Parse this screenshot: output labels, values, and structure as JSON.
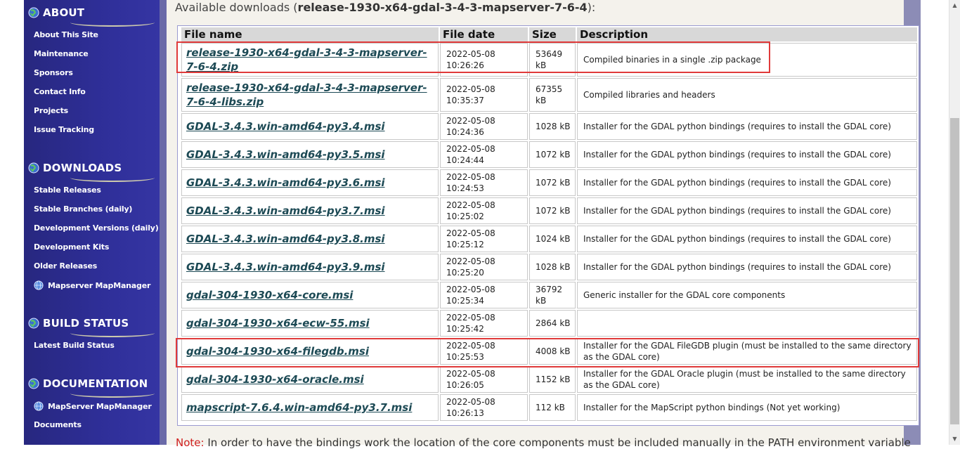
{
  "sidebar": {
    "sections": [
      {
        "title": "ABOUT",
        "items": [
          {
            "label": "About This Site"
          },
          {
            "label": "Maintenance"
          },
          {
            "label": "Sponsors"
          },
          {
            "label": "Contact Info"
          },
          {
            "label": "Projects"
          },
          {
            "label": "Issue Tracking"
          }
        ]
      },
      {
        "title": "DOWNLOADS",
        "items": [
          {
            "label": "Stable Releases"
          },
          {
            "label": "Stable Branches (daily)"
          },
          {
            "label": "Development Versions (daily)"
          },
          {
            "label": "Development Kits"
          },
          {
            "label": "Older Releases"
          },
          {
            "label": "Mapserver MapManager"
          }
        ]
      },
      {
        "title": "BUILD STATUS",
        "items": [
          {
            "label": "Latest Build Status"
          }
        ]
      },
      {
        "title": "DOCUMENTATION",
        "items": [
          {
            "label": "MapServer MapManager"
          },
          {
            "label": "Documents"
          }
        ]
      }
    ]
  },
  "header": {
    "prefix": "Available downloads (",
    "name": "release-1930-x64-gdal-3-4-3-mapserver-7-6-4",
    "suffix": "):"
  },
  "table": {
    "columns": [
      "File name",
      "File date",
      "Size",
      "Description"
    ],
    "rows": [
      {
        "name": "release-1930-x64-gdal-3-4-3-mapserver-7-6-4.zip",
        "date": "2022-05-08",
        "time": "10:26:26",
        "size": "53649 kB",
        "desc": "Compiled binaries in a single .zip package"
      },
      {
        "name": "release-1930-x64-gdal-3-4-3-mapserver-7-6-4-libs.zip",
        "date": "2022-05-08",
        "time": "10:35:37",
        "size": "67355 kB",
        "desc": "Compiled libraries and headers"
      },
      {
        "name": "GDAL-3.4.3.win-amd64-py3.4.msi",
        "date": "2022-05-08",
        "time": "10:24:36",
        "size": "1028 kB",
        "desc": "Installer for the GDAL python bindings (requires to install the GDAL core)"
      },
      {
        "name": "GDAL-3.4.3.win-amd64-py3.5.msi",
        "date": "2022-05-08",
        "time": "10:24:44",
        "size": "1072 kB",
        "desc": "Installer for the GDAL python bindings (requires to install the GDAL core)"
      },
      {
        "name": "GDAL-3.4.3.win-amd64-py3.6.msi",
        "date": "2022-05-08",
        "time": "10:24:53",
        "size": "1072 kB",
        "desc": "Installer for the GDAL python bindings (requires to install the GDAL core)"
      },
      {
        "name": "GDAL-3.4.3.win-amd64-py3.7.msi",
        "date": "2022-05-08",
        "time": "10:25:02",
        "size": "1072 kB",
        "desc": "Installer for the GDAL python bindings (requires to install the GDAL core)"
      },
      {
        "name": "GDAL-3.4.3.win-amd64-py3.8.msi",
        "date": "2022-05-08",
        "time": "10:25:12",
        "size": "1024 kB",
        "desc": "Installer for the GDAL python bindings (requires to install the GDAL core)"
      },
      {
        "name": "GDAL-3.4.3.win-amd64-py3.9.msi",
        "date": "2022-05-08",
        "time": "10:25:20",
        "size": "1028 kB",
        "desc": "Installer for the GDAL python bindings (requires to install the GDAL core)"
      },
      {
        "name": "gdal-304-1930-x64-core.msi",
        "date": "2022-05-08",
        "time": "10:25:34",
        "size": "36792 kB",
        "desc": "Generic installer for the GDAL core components"
      },
      {
        "name": "gdal-304-1930-x64-ecw-55.msi",
        "date": "2022-05-08",
        "time": "10:25:42",
        "size": "2864 kB",
        "desc": ""
      },
      {
        "name": "gdal-304-1930-x64-filegdb.msi",
        "date": "2022-05-08",
        "time": "10:25:53",
        "size": "4008 kB",
        "desc": "Installer for the GDAL FileGDB plugin (must be installed to the same directory as the GDAL core)"
      },
      {
        "name": "gdal-304-1930-x64-oracle.msi",
        "date": "2022-05-08",
        "time": "10:26:05",
        "size": "1152 kB",
        "desc": "Installer for the GDAL Oracle plugin (must be installed to the same directory as the GDAL core)"
      },
      {
        "name": "mapscript-7.6.4.win-amd64-py3.7.msi",
        "date": "2022-05-08",
        "time": "10:26:13",
        "size": "112 kB",
        "desc": "Installer for the MapScript python bindings (Not yet working)"
      }
    ]
  },
  "note": {
    "label": "Note:",
    "text": " In order to have the bindings work the location of the core components must be included manually in the PATH environment variable"
  },
  "colors": {
    "sidebar": "#2f2f99",
    "highlight": "#e03a3a",
    "link": "#1d4a55"
  },
  "icons": {
    "section": "globe-icon",
    "nav": "globe-icon"
  }
}
